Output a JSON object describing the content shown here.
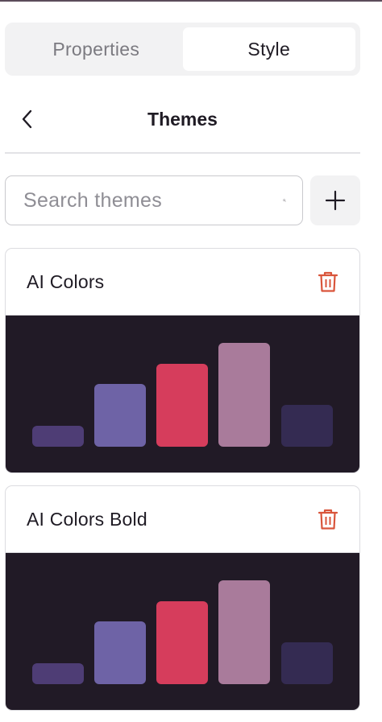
{
  "tabs": [
    {
      "label": "Properties",
      "active": false
    },
    {
      "label": "Style",
      "active": true
    }
  ],
  "header": {
    "title": "Themes"
  },
  "search": {
    "placeholder": "Search themes",
    "value": ""
  },
  "icons": {
    "back": "chevron-left-icon",
    "search": "search-icon",
    "add": "plus-icon",
    "delete": "trash-icon"
  },
  "colors": {
    "preview_background": "#211a26",
    "delete_icon": "#d9553b"
  },
  "themes": [
    {
      "name": "AI Colors",
      "palette": [
        "#4e3d75",
        "#6e63a6",
        "#d63d5c",
        "#a97b9b",
        "#342b52"
      ],
      "levels": [
        0.2,
        0.6,
        0.8,
        1.0,
        0.4
      ]
    },
    {
      "name": "AI Colors Bold",
      "palette": [
        "#4e3d75",
        "#6e63a6",
        "#d63d5c",
        "#a97b9b",
        "#342b52"
      ],
      "levels": [
        0.2,
        0.6,
        0.8,
        1.0,
        0.4
      ]
    }
  ]
}
